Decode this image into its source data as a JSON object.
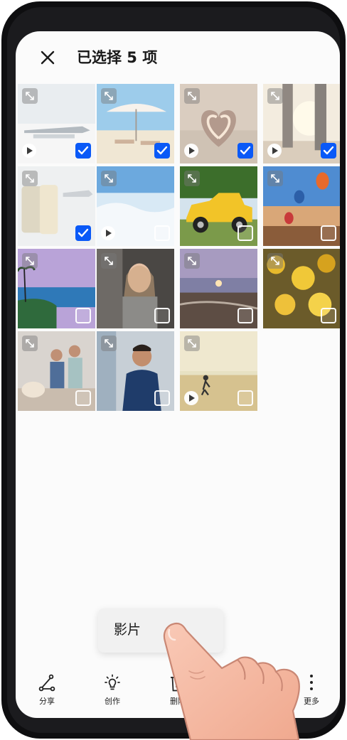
{
  "header": {
    "title": "已选择 5 项",
    "close_icon": "close-icon"
  },
  "grid": {
    "columns": 4,
    "tiles": [
      {
        "id": "airport-luggage",
        "subject": "airport",
        "selected": true,
        "video": true
      },
      {
        "id": "beach-umbrella",
        "subject": "beach",
        "selected": true,
        "video": false
      },
      {
        "id": "heart-hands-sunset",
        "subject": "heart",
        "selected": true,
        "video": true
      },
      {
        "id": "couple-walking",
        "subject": "couple",
        "selected": true,
        "video": true
      },
      {
        "id": "suitcases",
        "subject": "luggage",
        "selected": true,
        "video": false
      },
      {
        "id": "ocean-waves",
        "subject": "waves",
        "selected": false,
        "video": true
      },
      {
        "id": "yellow-vintage-car",
        "subject": "car",
        "selected": false,
        "video": false
      },
      {
        "id": "hot-air-balloons",
        "subject": "balloons",
        "selected": false,
        "video": false
      },
      {
        "id": "tropical-coast",
        "subject": "coast",
        "selected": false,
        "video": false
      },
      {
        "id": "girl-selfie",
        "subject": "girl",
        "selected": false,
        "video": false
      },
      {
        "id": "sunset-shore",
        "subject": "shore",
        "selected": false,
        "video": false
      },
      {
        "id": "ginkgo-leaves",
        "subject": "ginkgo",
        "selected": false,
        "video": false
      },
      {
        "id": "family-with-dog",
        "subject": "family",
        "selected": false,
        "video": false
      },
      {
        "id": "smiling-man",
        "subject": "man",
        "selected": false,
        "video": false
      },
      {
        "id": "child-running-beach",
        "subject": "child",
        "selected": false,
        "video": true
      }
    ]
  },
  "popup": {
    "label": "影片"
  },
  "bottom_bar": {
    "items": [
      {
        "label": "分享",
        "icon": "share-icon"
      },
      {
        "label": "创作",
        "icon": "create-bulb-icon"
      },
      {
        "label": "删除",
        "icon": "delete-icon"
      },
      {
        "label": "更多",
        "icon": "more-vertical-icon"
      }
    ]
  },
  "colors": {
    "accent": "#0a59f7",
    "background": "#fbfbfb",
    "device_frame": "#0e0e10"
  }
}
